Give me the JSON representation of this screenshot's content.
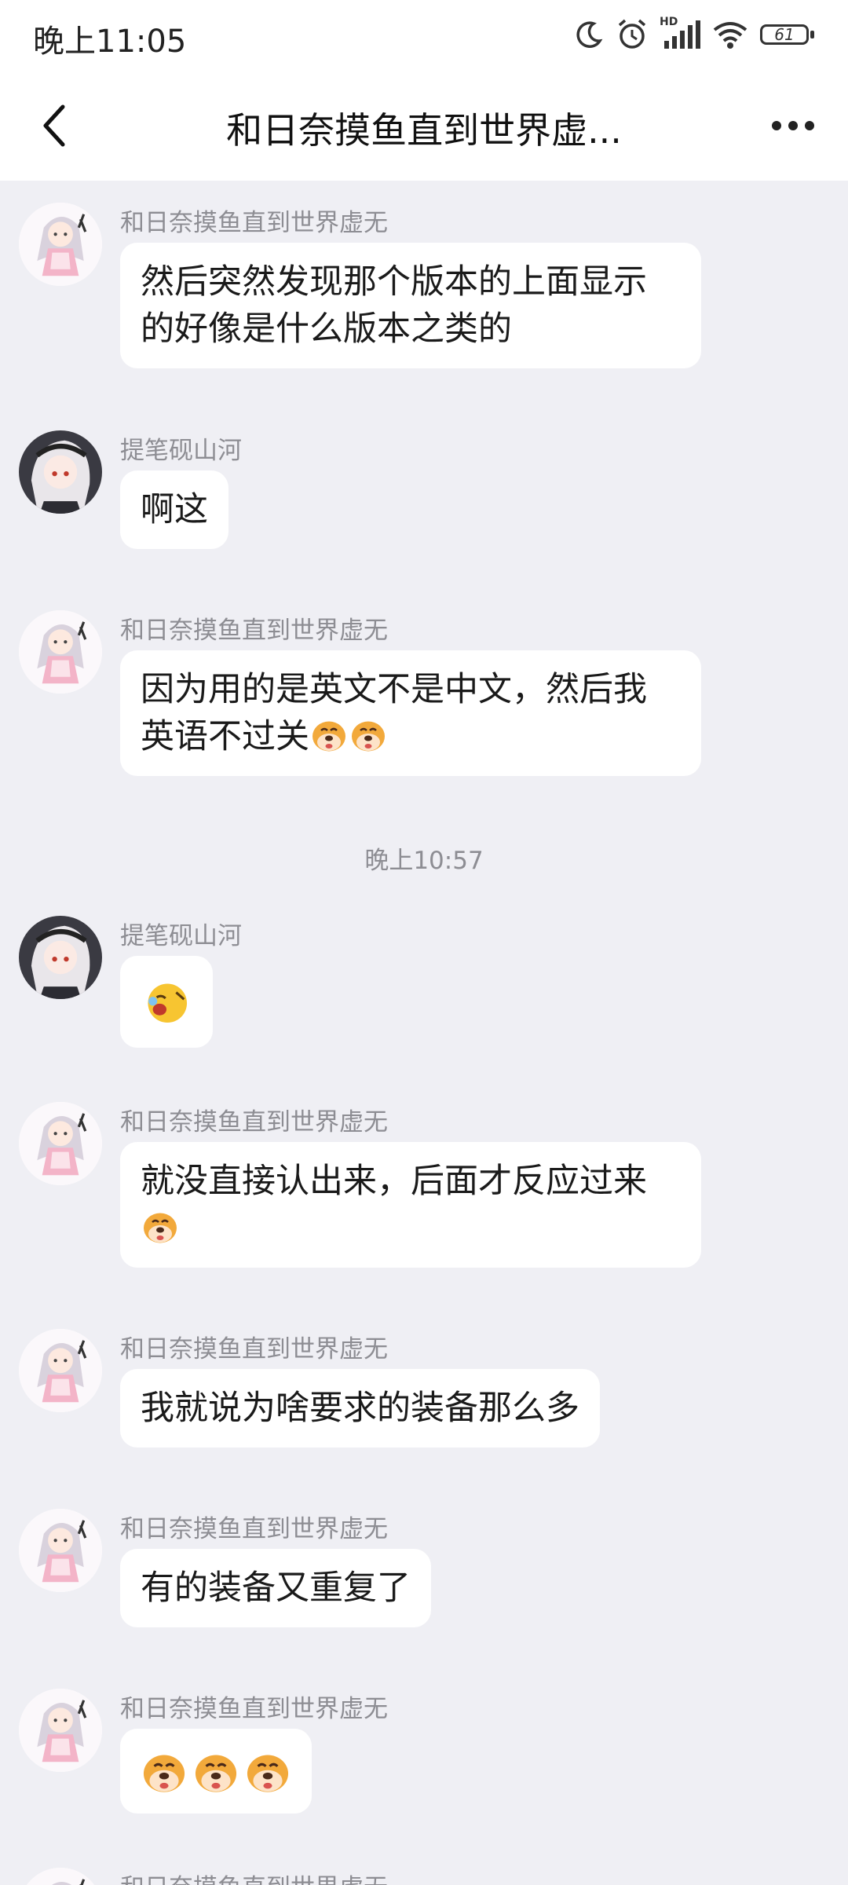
{
  "status": {
    "time": "晚上11:05",
    "battery": "61",
    "hd_label": "HD"
  },
  "header": {
    "title": "和日奈摸鱼直到世界虚..."
  },
  "messages": [
    {
      "sender": "和日奈摸鱼直到世界虚无",
      "lines": [
        "然后突然发现那个版本的上面显示",
        "的好像是什么版本之类的"
      ]
    },
    {
      "sender": "提笔砚山河",
      "lines": [
        "啊这"
      ]
    },
    {
      "sender": "和日奈摸鱼直到世界虚无",
      "lines": [
        "因为用的是英文不是中文，然后我",
        "英语不过关"
      ],
      "trailing_emoji": [
        "dog-face",
        "dog-face"
      ]
    },
    {
      "timestamp": "晚上10:57"
    },
    {
      "sender": "提笔砚山河",
      "emoji_only": [
        "yawn-face"
      ]
    },
    {
      "sender": "和日奈摸鱼直到世界虚无",
      "lines": [
        "就没直接认出来，后面才反应过来"
      ],
      "trailing_emoji": [
        "dog-face"
      ]
    },
    {
      "sender": "和日奈摸鱼直到世界虚无",
      "lines": [
        "我就说为啥要求的装备那么多"
      ]
    },
    {
      "sender": "和日奈摸鱼直到世界虚无",
      "lines": [
        "有的装备又重复了"
      ]
    },
    {
      "sender": "和日奈摸鱼直到世界虚无",
      "emoji_only": [
        "dog-face",
        "dog-face",
        "dog-face"
      ]
    },
    {
      "sender": "和日奈摸鱼直到世界虚无"
    }
  ],
  "icons": {
    "back": "chevron-left-icon",
    "more": "more-dots-icon",
    "moon": "moon-icon",
    "alarm": "alarm-icon",
    "signal": "signal-icon",
    "wifi": "wifi-icon",
    "battery": "battery-icon"
  },
  "colors": {
    "background": "#efeff4",
    "bubble": "#ffffff",
    "meta_text": "#8d8d93"
  }
}
